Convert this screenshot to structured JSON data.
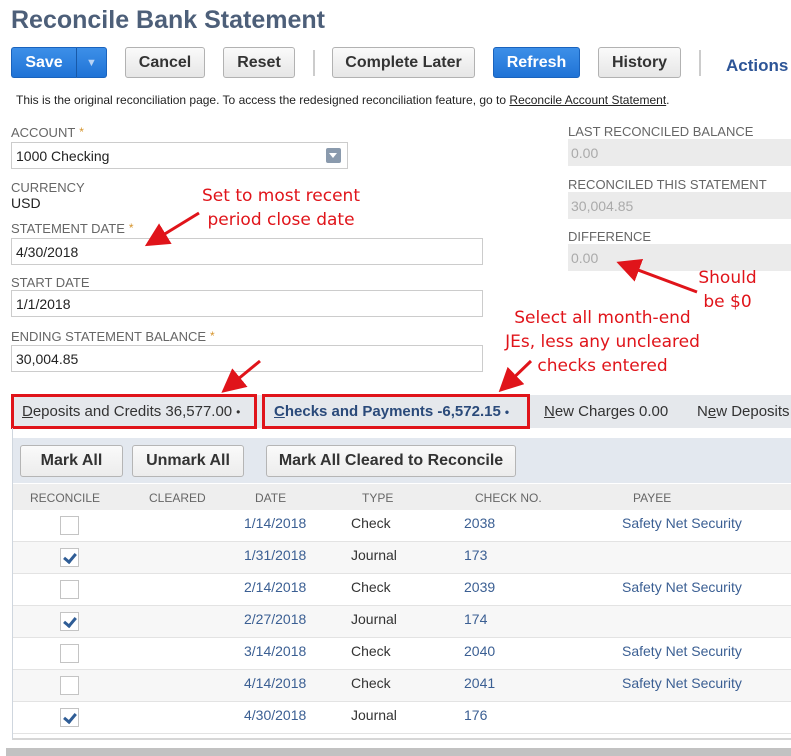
{
  "page": {
    "title": "Reconcile Bank Statement"
  },
  "toolbar": {
    "save": "Save",
    "save_menu_icon": "▼",
    "cancel": "Cancel",
    "reset": "Reset",
    "complete_later": "Complete Later",
    "refresh": "Refresh",
    "history": "History",
    "actions": "Actions"
  },
  "info": {
    "text": "This is the original reconciliation page. To access the redesigned reconciliation feature, go to ",
    "link": "Reconcile Account Statement",
    "suffix": "."
  },
  "form": {
    "account": {
      "label": "Account",
      "value": "1000 Checking",
      "required": "*"
    },
    "currency": {
      "label": "Currency",
      "value": "USD"
    },
    "statement_date": {
      "label": "Statement Date",
      "value": "4/30/2018",
      "required": "*"
    },
    "start_date": {
      "label": "Start Date",
      "value": "1/1/2018"
    },
    "ending_balance": {
      "label": "Ending Statement Balance",
      "value": "30,004.85",
      "required": "*"
    },
    "last_reconciled_balance": {
      "label": "Last Reconciled Balance",
      "value": "0.00"
    },
    "reconciled_this_statement": {
      "label": "Reconciled This Statement",
      "value": "30,004.85"
    },
    "difference": {
      "label": "Difference",
      "value": "0.00"
    }
  },
  "tabs": [
    {
      "accesskey": "D",
      "rest": "eposits and Credits 36,577.00",
      "dot": "•"
    },
    {
      "accesskey": "C",
      "rest": "hecks and Payments -6,572.15",
      "dot": "•"
    },
    {
      "accesskey": "N",
      "rest": "ew Charges 0.00"
    },
    {
      "pre": "N",
      "accesskey": "e",
      "rest": "w Deposits"
    }
  ],
  "subtoolbar": {
    "mark_all": "Mark All",
    "unmark_all": "Unmark All",
    "mark_all_cleared": "Mark All Cleared to Reconcile"
  },
  "table": {
    "columns": [
      "Reconcile",
      "Cleared",
      "Date",
      "Type",
      "Check No.",
      "Payee"
    ],
    "rows": [
      {
        "reconcile": false,
        "date": "1/14/2018",
        "type": "Check",
        "check_no": "2038",
        "payee": "Safety Net Security"
      },
      {
        "reconcile": true,
        "date": "1/31/2018",
        "type": "Journal",
        "check_no": "173",
        "payee": ""
      },
      {
        "reconcile": false,
        "date": "2/14/2018",
        "type": "Check",
        "check_no": "2039",
        "payee": "Safety Net Security"
      },
      {
        "reconcile": true,
        "date": "2/27/2018",
        "type": "Journal",
        "check_no": "174",
        "payee": ""
      },
      {
        "reconcile": false,
        "date": "3/14/2018",
        "type": "Check",
        "check_no": "2040",
        "payee": "Safety Net Security"
      },
      {
        "reconcile": false,
        "date": "4/14/2018",
        "type": "Check",
        "check_no": "2041",
        "payee": "Safety Net Security"
      },
      {
        "reconcile": true,
        "date": "4/30/2018",
        "type": "Journal",
        "check_no": "176",
        "payee": ""
      }
    ]
  },
  "annotations": {
    "statement_date_note": [
      "Set to most recent",
      "period close date"
    ],
    "difference_note": [
      "Should",
      "be $0"
    ],
    "checks_note": [
      "Select all month-end",
      "JEs, less any uncleared",
      "checks entered"
    ],
    "color": "#e0141a"
  }
}
